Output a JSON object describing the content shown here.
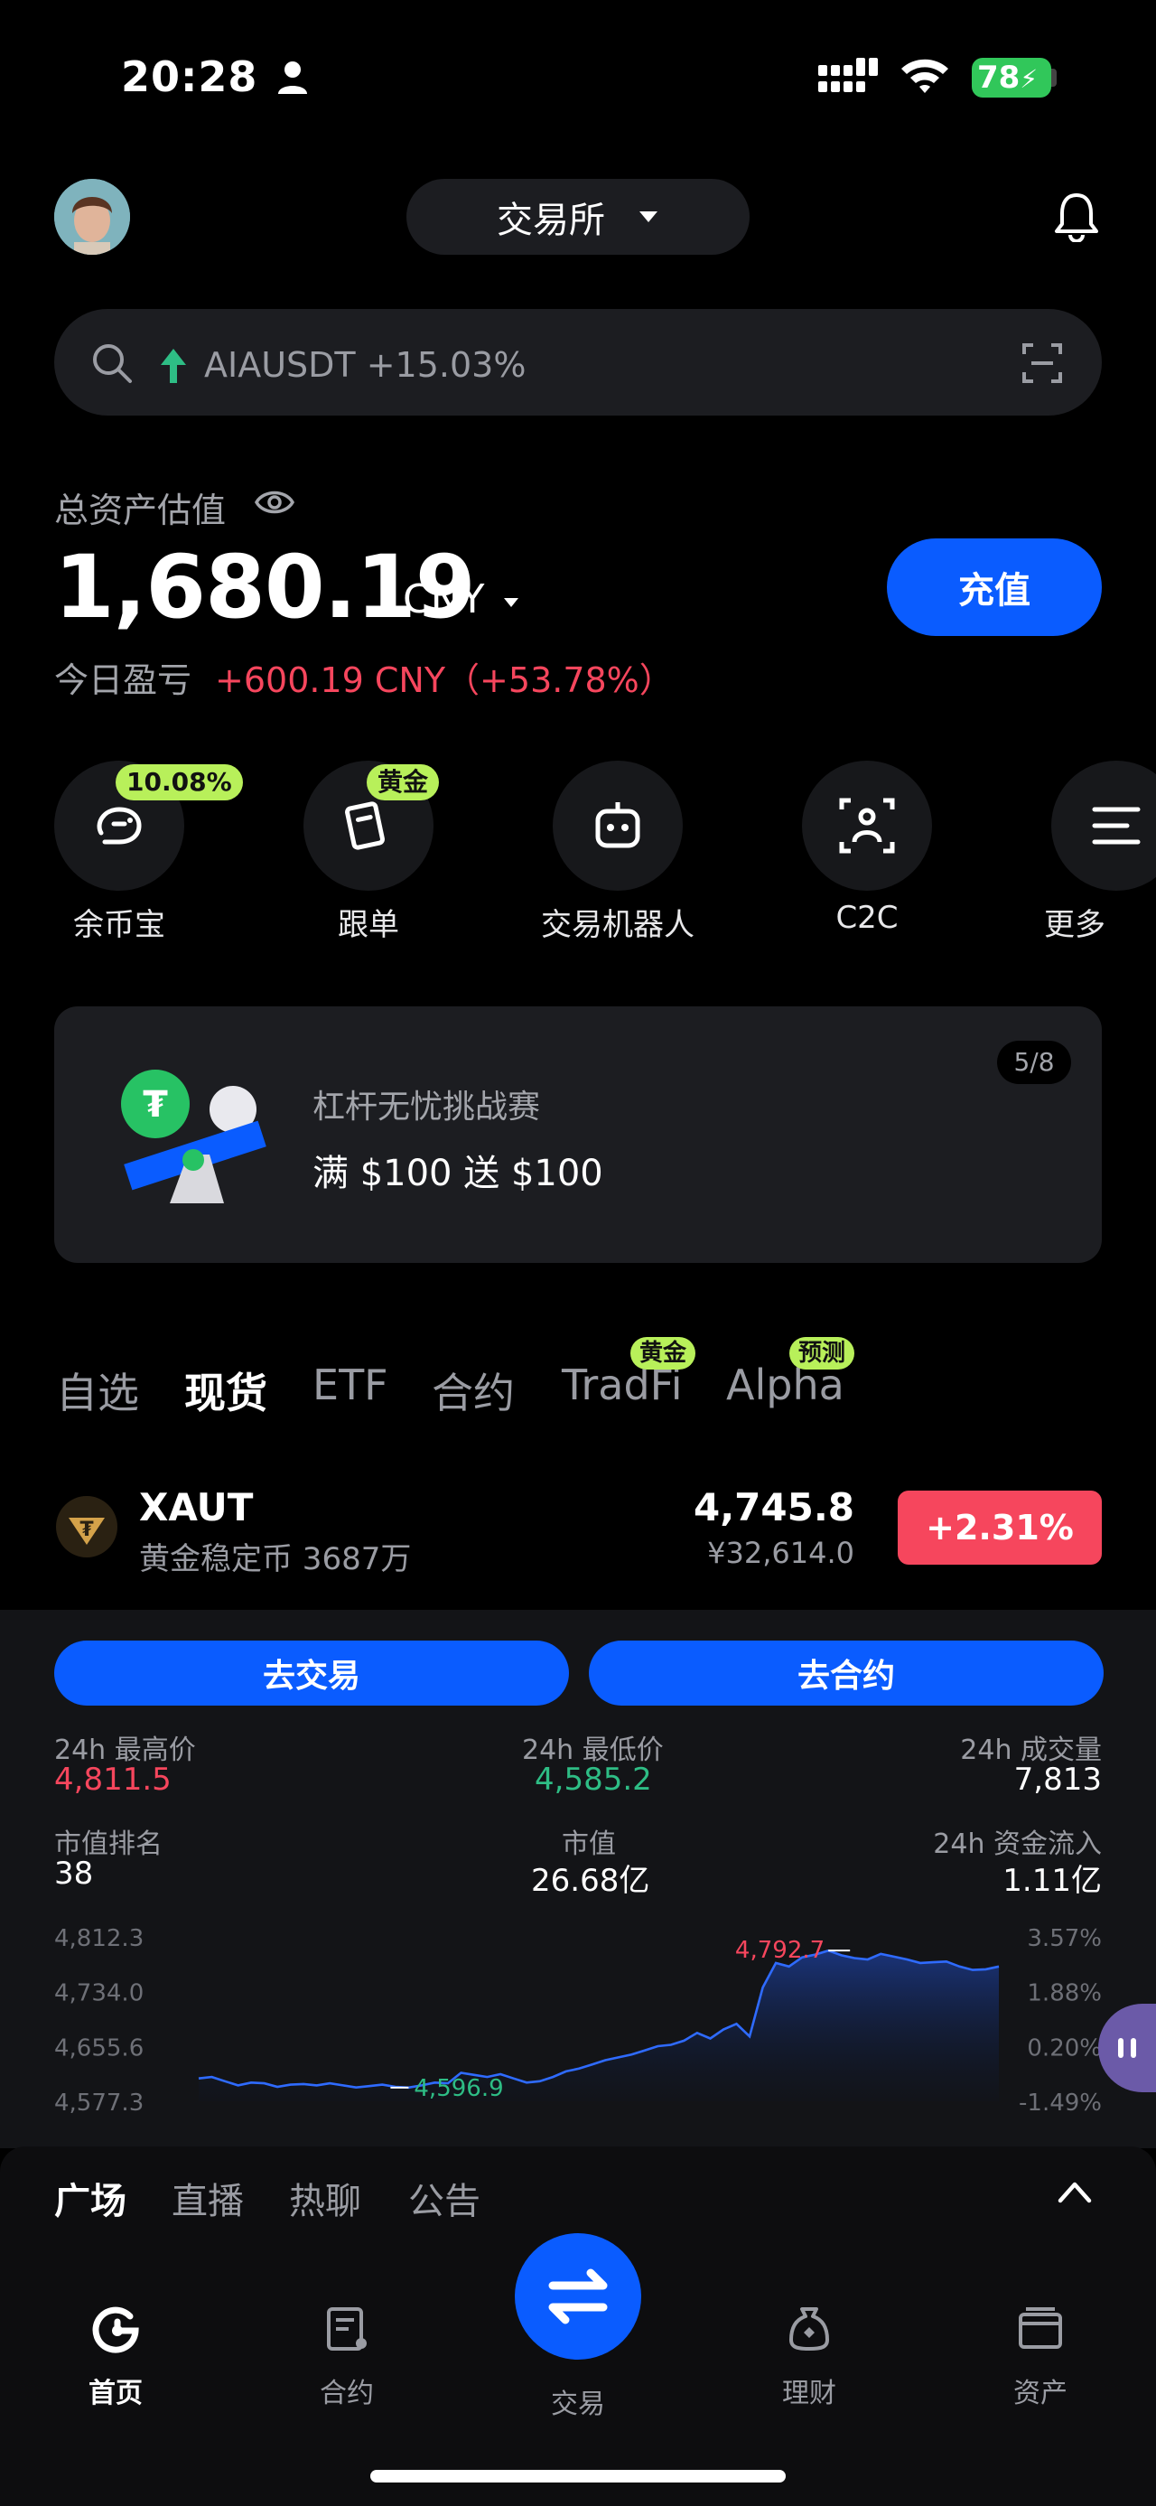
{
  "status_bar": {
    "time": "20:28",
    "battery": "78"
  },
  "header": {
    "exchange_label": "交易所"
  },
  "search": {
    "ticker": "AIAUSDT",
    "change": "+15.03%"
  },
  "assets": {
    "label": "总资产估值",
    "total": "1,680.19",
    "currency": "CNY",
    "pnl_label": "今日盈亏",
    "pnl_value": "+600.19 CNY（+53.78%）",
    "deposit_label": "充值"
  },
  "quick_actions": [
    {
      "label": "余币宝",
      "badge": "10.08%"
    },
    {
      "label": "跟单",
      "badge": "黄金"
    },
    {
      "label": "交易机器人",
      "badge": ""
    },
    {
      "label": "C2C",
      "badge": ""
    },
    {
      "label": "更多",
      "badge": ""
    }
  ],
  "banner": {
    "title": "杠杆无忧挑战赛",
    "subtitle": "满 $100 送 $100",
    "page": "5/8"
  },
  "market_tabs": [
    {
      "label": "自选",
      "badge": ""
    },
    {
      "label": "现货",
      "badge": ""
    },
    {
      "label": "ETF",
      "badge": ""
    },
    {
      "label": "合约",
      "badge": ""
    },
    {
      "label": "TradFi",
      "badge": "黄金"
    },
    {
      "label": "Alpha",
      "badge": "预测"
    }
  ],
  "coin": {
    "name": "XAUT",
    "subtitle": "黄金稳定币 3687万",
    "price": "4,745.8",
    "price_cny": "¥32,614.0",
    "change": "+2.31%"
  },
  "detail": {
    "go_trade": "去交易",
    "go_contract": "去合约",
    "stats": [
      {
        "label": "24h 最高价",
        "value": "4,811.5"
      },
      {
        "label": "24h 最低价",
        "value": "4,585.2"
      },
      {
        "label": "24h 成交量",
        "value": "7,813"
      },
      {
        "label": "市值排名",
        "value": "38"
      },
      {
        "label": "市值",
        "value": "26.68亿"
      },
      {
        "label": "24h 资金流入",
        "value": "1.11亿"
      }
    ]
  },
  "chart_data": {
    "type": "area",
    "y_left_ticks": [
      "4,812.3",
      "4,734.0",
      "4,655.6",
      "4,577.3"
    ],
    "y_right_ticks": [
      "3.57%",
      "1.88%",
      "0.20%",
      "-1.49%"
    ],
    "ylim": [
      4577.3,
      4812.3
    ],
    "values": [
      4610,
      4612,
      4606,
      4600,
      4604,
      4603,
      4598,
      4601,
      4602,
      4600,
      4603,
      4600,
      4597,
      4599,
      4601,
      4598,
      4596.9,
      4600,
      4604,
      4603,
      4618,
      4615,
      4612,
      4616,
      4610,
      4604,
      4606,
      4612,
      4620,
      4624,
      4630,
      4636,
      4640,
      4644,
      4650,
      4656,
      4658,
      4664,
      4675,
      4667,
      4680,
      4688,
      4670,
      4740,
      4775,
      4770,
      4783,
      4787,
      4792.7,
      4786,
      4782,
      4780,
      4788,
      4784,
      4780,
      4775,
      4776,
      4777,
      4770,
      4765,
      4766,
      4770
    ],
    "max_label": "4,792.7",
    "min_label": "4,596.9"
  },
  "bottom_tabs": [
    "广场",
    "直播",
    "热聊",
    "公告"
  ],
  "nav": [
    {
      "label": "首页"
    },
    {
      "label": "合约"
    },
    {
      "label": "交易"
    },
    {
      "label": "理财"
    },
    {
      "label": "资产"
    }
  ],
  "colors": {
    "accent": "#0a5cff",
    "up": "#f6465d",
    "down": "#2ebd85",
    "badge": "#b8f05a",
    "line": "#2f6bff"
  }
}
